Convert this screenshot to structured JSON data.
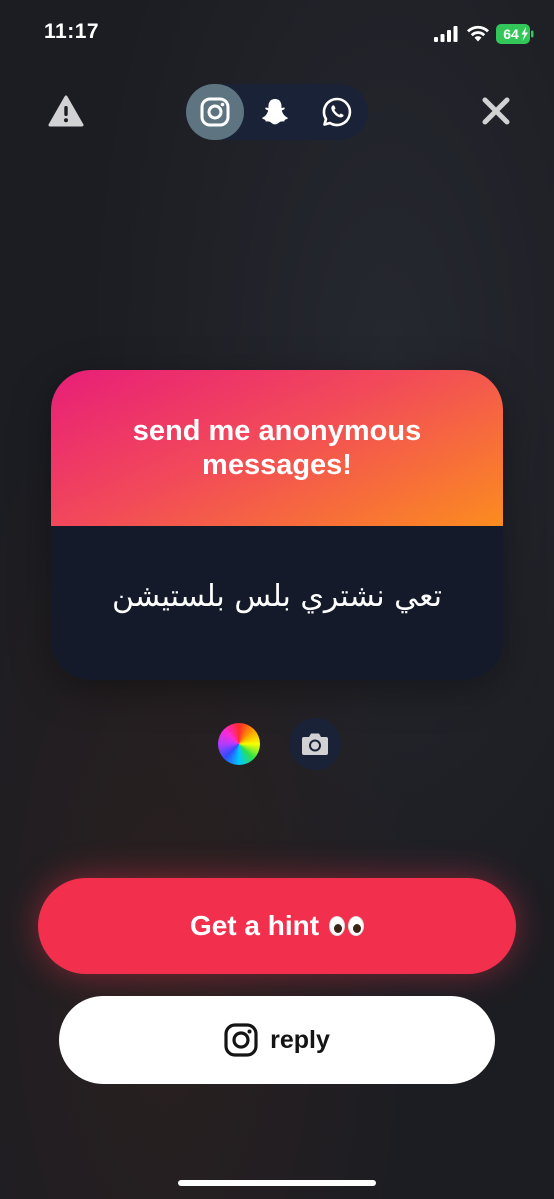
{
  "status_bar": {
    "time": "11:17",
    "battery": "64"
  },
  "card": {
    "prompt": "send me anonymous messages!",
    "message": "تعي نشتري بلس بلستيشن"
  },
  "buttons": {
    "hint_label": "Get a hint",
    "reply_label": "reply"
  },
  "share": {
    "items": [
      "instagram-icon",
      "snapchat-icon",
      "whatsapp-icon"
    ],
    "active": "instagram"
  },
  "colors": {
    "background": "#1c1d22",
    "hint": "#f2304d",
    "share_pill": "#192236",
    "active_share": "#5e7480",
    "card_gradient": [
      "#e81e78",
      "#f2495a",
      "#fb8c1f"
    ],
    "card_body": "#141a29",
    "battery": "#33c759"
  }
}
